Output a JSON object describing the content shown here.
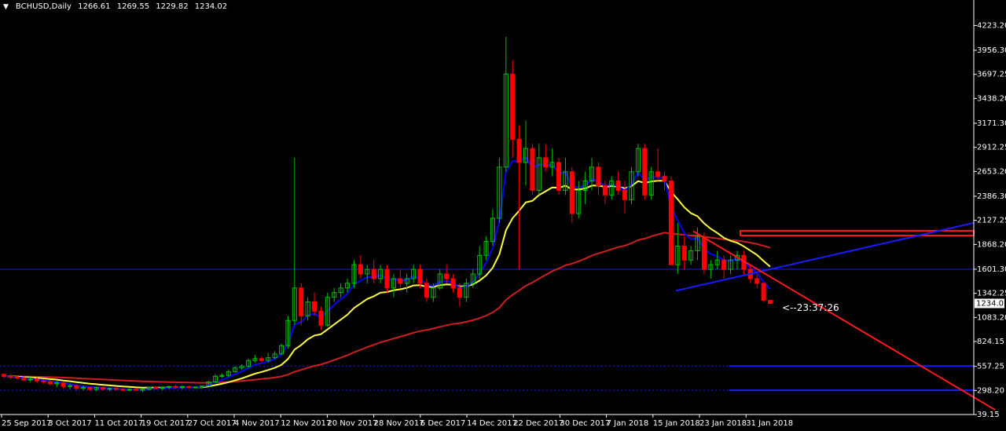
{
  "header": {
    "symbol": "BCHUSD,Daily",
    "open": "1266.61",
    "high": "1269.55",
    "low": "1229.82",
    "close": "1234.02"
  },
  "price_badge": "1234.02",
  "timer_text": "<--23:37:26",
  "colors": {
    "background": "#000000",
    "bull": "#00c000",
    "bear": "#ff0000",
    "text": "#ffffff",
    "ma_fast": "#0000ff",
    "ma_mid": "#ffff40",
    "ma_slow": "#cc2020",
    "trendline_blue": "#1a1aff",
    "trendline_red": "#ff1a1a"
  },
  "chart_data": {
    "type": "candlestick",
    "title": "BCHUSD,Daily",
    "ylim": [
      39.15,
      4370
    ],
    "y_ticks": [
      "4223.20",
      "3956.30",
      "3697.25",
      "3438.20",
      "3171.30",
      "2912.25",
      "2653.20",
      "2386.30",
      "2127.25",
      "1868.20",
      "1601.30",
      "1342.25",
      "1083.20",
      "824.15",
      "557.25",
      "298.20",
      "39.15"
    ],
    "x_tick_labels": [
      "25 Sep 2017",
      "3 Oct 2017",
      "11 Oct 2017",
      "19 Oct 2017",
      "27 Oct 2017",
      "4 Nov 2017",
      "12 Nov 2017",
      "20 Nov 2017",
      "28 Nov 2017",
      "6 Dec 2017",
      "14 Dec 2017",
      "22 Dec 2017",
      "30 Dec 2017",
      "7 Jan 2018",
      "15 Jan 2018",
      "23 Jan 2018",
      "31 Jan 2018"
    ],
    "candles": [
      [
        470,
        480,
        430,
        450
      ],
      [
        450,
        470,
        420,
        440
      ],
      [
        440,
        460,
        410,
        430
      ],
      [
        430,
        450,
        400,
        410
      ],
      [
        410,
        440,
        390,
        420
      ],
      [
        420,
        440,
        380,
        400
      ],
      [
        400,
        420,
        370,
        390
      ],
      [
        390,
        410,
        350,
        370
      ],
      [
        370,
        400,
        330,
        380
      ],
      [
        380,
        390,
        320,
        340
      ],
      [
        340,
        370,
        310,
        350
      ],
      [
        350,
        360,
        300,
        320
      ],
      [
        320,
        350,
        300,
        330
      ],
      [
        330,
        340,
        290,
        310
      ],
      [
        310,
        340,
        290,
        330
      ],
      [
        330,
        340,
        300,
        310
      ],
      [
        310,
        330,
        290,
        320
      ],
      [
        320,
        330,
        300,
        310
      ],
      [
        310,
        320,
        290,
        300
      ],
      [
        300,
        320,
        290,
        310
      ],
      [
        310,
        320,
        290,
        300
      ],
      [
        300,
        320,
        280,
        310
      ],
      [
        310,
        340,
        300,
        330
      ],
      [
        330,
        340,
        310,
        320
      ],
      [
        320,
        340,
        300,
        330
      ],
      [
        330,
        350,
        310,
        340
      ],
      [
        340,
        360,
        320,
        330
      ],
      [
        330,
        350,
        310,
        340
      ],
      [
        340,
        350,
        320,
        330
      ],
      [
        330,
        340,
        320,
        335
      ],
      [
        335,
        350,
        330,
        345
      ],
      [
        345,
        400,
        340,
        390
      ],
      [
        390,
        470,
        380,
        450
      ],
      [
        450,
        480,
        430,
        460
      ],
      [
        460,
        520,
        440,
        500
      ],
      [
        500,
        560,
        490,
        540
      ],
      [
        540,
        580,
        520,
        560
      ],
      [
        560,
        640,
        540,
        620
      ],
      [
        620,
        680,
        600,
        640
      ],
      [
        640,
        660,
        600,
        620
      ],
      [
        620,
        700,
        600,
        650
      ],
      [
        650,
        720,
        630,
        690
      ],
      [
        690,
        800,
        680,
        780
      ],
      [
        780,
        1100,
        750,
        1050
      ],
      [
        1050,
        2800,
        1000,
        1400
      ],
      [
        1400,
        1450,
        1000,
        1100
      ],
      [
        1100,
        1300,
        1050,
        1250
      ],
      [
        1250,
        1350,
        1100,
        1150
      ],
      [
        1150,
        1200,
        950,
        1000
      ],
      [
        1000,
        1350,
        980,
        1300
      ],
      [
        1300,
        1400,
        1250,
        1350
      ],
      [
        1350,
        1450,
        1300,
        1400
      ],
      [
        1400,
        1500,
        1350,
        1450
      ],
      [
        1450,
        1700,
        1400,
        1650
      ],
      [
        1650,
        1750,
        1500,
        1550
      ],
      [
        1550,
        1650,
        1450,
        1600
      ],
      [
        1600,
        1700,
        1450,
        1500
      ],
      [
        1500,
        1650,
        1450,
        1600
      ],
      [
        1600,
        1650,
        1350,
        1400
      ],
      [
        1400,
        1550,
        1300,
        1500
      ],
      [
        1500,
        1600,
        1400,
        1450
      ],
      [
        1450,
        1550,
        1350,
        1500
      ],
      [
        1500,
        1650,
        1450,
        1600
      ],
      [
        1600,
        1650,
        1400,
        1450
      ],
      [
        1450,
        1500,
        1250,
        1300
      ],
      [
        1300,
        1450,
        1250,
        1400
      ],
      [
        1400,
        1600,
        1380,
        1550
      ],
      [
        1550,
        1650,
        1450,
        1500
      ],
      [
        1500,
        1550,
        1350,
        1400
      ],
      [
        1400,
        1450,
        1200,
        1300
      ],
      [
        1300,
        1500,
        1250,
        1450
      ],
      [
        1450,
        1600,
        1400,
        1550
      ],
      [
        1550,
        1850,
        1500,
        1750
      ],
      [
        1750,
        1950,
        1700,
        1900
      ],
      [
        1900,
        2250,
        1850,
        2150
      ],
      [
        2150,
        2800,
        2100,
        2700
      ],
      [
        2700,
        4100,
        2650,
        3700
      ],
      [
        3700,
        3850,
        2800,
        3000
      ],
      [
        3000,
        3150,
        1600,
        2750
      ],
      [
        2750,
        3200,
        2500,
        2900
      ],
      [
        2900,
        2950,
        2400,
        2450
      ],
      [
        2450,
        2950,
        2400,
        2800
      ],
      [
        2800,
        2950,
        2650,
        2700
      ],
      [
        2700,
        2900,
        2600,
        2750
      ],
      [
        2750,
        2800,
        2400,
        2450
      ],
      [
        2450,
        2800,
        2400,
        2650
      ],
      [
        2650,
        2700,
        2100,
        2200
      ],
      [
        2200,
        2550,
        2150,
        2450
      ],
      [
        2450,
        2650,
        2300,
        2550
      ],
      [
        2550,
        2800,
        2450,
        2700
      ],
      [
        2700,
        2750,
        2400,
        2500
      ],
      [
        2500,
        2550,
        2300,
        2400
      ],
      [
        2400,
        2600,
        2350,
        2550
      ],
      [
        2550,
        2650,
        2400,
        2450
      ],
      [
        2450,
        2550,
        2200,
        2350
      ],
      [
        2350,
        2700,
        2300,
        2650
      ],
      [
        2650,
        2950,
        2600,
        2900
      ],
      [
        2900,
        2950,
        2350,
        2400
      ],
      [
        2400,
        2700,
        2350,
        2650
      ],
      [
        2650,
        2900,
        2550,
        2600
      ],
      [
        2600,
        2650,
        2450,
        2550
      ],
      [
        2550,
        2600,
        1700,
        1650
      ],
      [
        1650,
        2100,
        1550,
        1850
      ],
      [
        1850,
        1950,
        1600,
        1700
      ],
      [
        1700,
        1850,
        1650,
        1800
      ],
      [
        1800,
        2050,
        1700,
        1950
      ],
      [
        1950,
        2000,
        1550,
        1600
      ],
      [
        1600,
        1700,
        1500,
        1650
      ],
      [
        1650,
        1800,
        1600,
        1700
      ],
      [
        1700,
        1750,
        1500,
        1600
      ],
      [
        1600,
        1750,
        1550,
        1700
      ],
      [
        1700,
        1800,
        1600,
        1750
      ],
      [
        1750,
        1800,
        1550,
        1600
      ],
      [
        1600,
        1650,
        1450,
        1500
      ],
      [
        1500,
        1550,
        1400,
        1450
      ],
      [
        1450,
        1450,
        1250,
        1266.61
      ],
      [
        1266.61,
        1269.55,
        1229.82,
        1234.02
      ]
    ]
  }
}
